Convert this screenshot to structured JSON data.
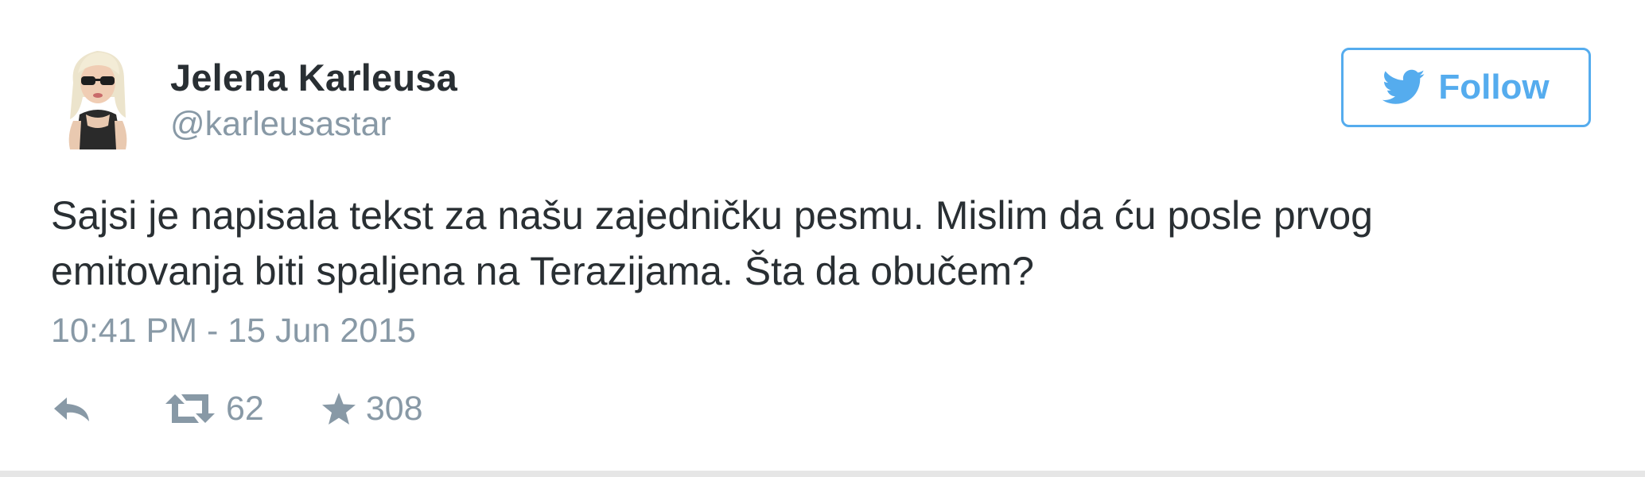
{
  "user": {
    "display_name": "Jelena Karleusa",
    "handle": "@karleusastar",
    "avatar_icon": "profile-avatar"
  },
  "follow_button": {
    "label": "Follow",
    "icon": "twitter-bird-icon",
    "color": "#55acee"
  },
  "tweet": {
    "text_lines": [
      "Sajsi je napisala tekst za našu zajedničku pesmu. Mislim da ću posle prvog",
      "emitovanja biti spaljena na Terazijama. Šta da obučem?"
    ],
    "timestamp": "10:41 PM - 15 Jun 2015"
  },
  "actions": {
    "reply_icon": "reply-icon",
    "retweet_icon": "retweet-icon",
    "retweet_count": "62",
    "favorite_icon": "star-icon",
    "favorite_count": "308"
  },
  "colors": {
    "text": "#292f33",
    "muted": "#8899a6",
    "accent": "#55acee"
  }
}
